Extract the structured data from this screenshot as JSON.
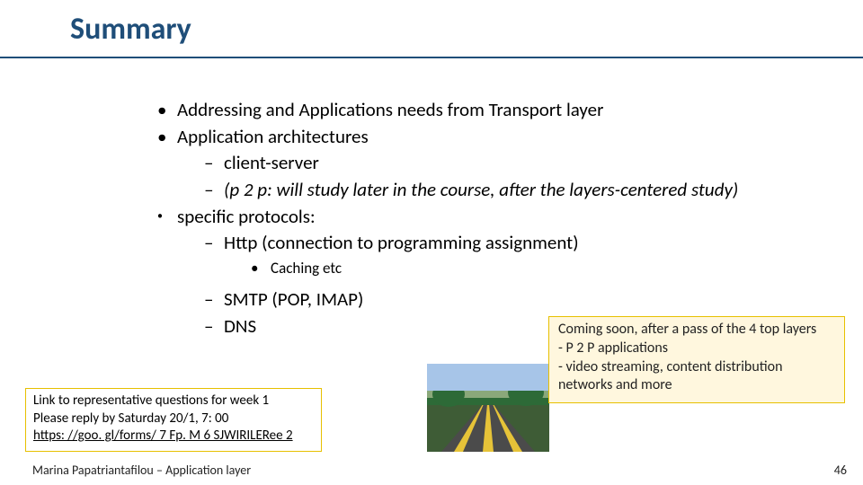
{
  "title": "Summary",
  "bullets": {
    "b0": "Addressing and Applications needs from Transport layer",
    "b1": "Application architectures",
    "b1a": "client-server",
    "b1b": "(p 2 p: will study later in the course, after the layers-centered study)",
    "b2": "specific protocols:",
    "b2a": "Http (connection to programming assignment)",
    "b2a1": "Caching etc",
    "b2b": "SMTP (POP, IMAP)",
    "b2c": "DNS"
  },
  "note_left": {
    "l1": "Link to representative questions for week 1",
    "l2": "Please reply by Saturday 20/1, 7: 00",
    "l3": "https: //goo. gl/forms/ 7 Fp. M 6 SJWIRILERee 2"
  },
  "note_right": {
    "l1": "Coming soon, after a pass of the 4 top layers",
    "l2": "- P 2 P applications",
    "l3": "- video streaming, content distribution networks and more"
  },
  "footer": {
    "left": "Marina Papatriantafilou –  Application layer",
    "right": "46"
  }
}
